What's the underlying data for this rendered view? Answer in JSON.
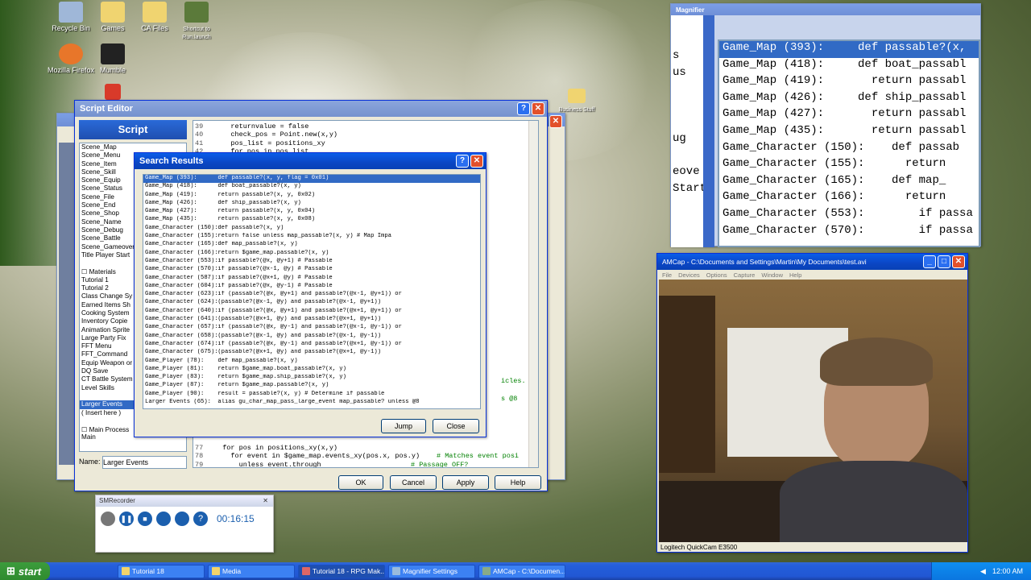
{
  "desktop": {
    "icons": [
      {
        "label": "Recycle Bin",
        "color": "#9fb7d8"
      },
      {
        "label": "Games",
        "color": "#f0d470"
      },
      {
        "label": "CA Files",
        "color": "#f0d470"
      },
      {
        "label": "Shortcut to Run.launch",
        "color": "#5b7a3a"
      },
      {
        "label": "Mozilla Firefox",
        "color": "#e8762a"
      },
      {
        "label": "Mumble",
        "color": "#222222"
      },
      {
        "label": "",
        "color": "#d83a2a"
      },
      {
        "label": "Business Stuff",
        "color": "#f0d470"
      }
    ]
  },
  "script_editor": {
    "title": "Script Editor",
    "panel_header": "Script",
    "scripts": [
      "Scene_Map",
      "Scene_Menu",
      "Scene_Item",
      "Scene_Skill",
      "Scene_Equip",
      "Scene_Status",
      "Scene_File",
      "Scene_End",
      "Scene_Shop",
      "Scene_Name",
      "Scene_Debug",
      "Scene_Battle",
      "Scene_Gameover",
      "Title Player Start",
      "",
      "☐ Materials",
      "Tutorial 1",
      "Tutorial 2",
      "Class Change Sy",
      "Earned Items Sh",
      "Cooking System",
      "Inventory Copie",
      "Animation Sprite",
      "Large Party Fix",
      "FFT Menu",
      "FFT_Command",
      "Equip Weapon or",
      "DQ Save",
      "CT Battle System",
      "Level Skills",
      "",
      "Larger Events",
      "( Insert here )",
      "",
      "☐ Main Process",
      "Main"
    ],
    "selected_script": "Larger Events",
    "name_label": "Name:",
    "name_value": "Larger Events",
    "code_top": [
      {
        "n": "39",
        "t": "    returnvalue = false"
      },
      {
        "n": "40",
        "t": "    check_pos = Point.new(x,y)"
      },
      {
        "n": "41",
        "t": "    pos_list = positions_xy"
      },
      {
        "n": "42",
        "t": "    for pos in pos_list"
      }
    ],
    "code_bottom": [
      {
        "n": "77",
        "t": "  for pos in positions_xy(x,y)"
      },
      {
        "n": "78",
        "t": "    for event in $game_map.events_xy(pos.x, pos.y)",
        "c": "# Matches event posi"
      },
      {
        "n": "79",
        "t": "      unless event.through",
        "c": "# Passage OFF?"
      }
    ],
    "right_fragments": [
      "icles.",
      "s @8"
    ],
    "buttons": {
      "ok": "OK",
      "cancel": "Cancel",
      "apply": "Apply",
      "help": "Help"
    }
  },
  "search_results": {
    "title": "Search Results",
    "results": [
      {
        "loc": "Game_Map (393):",
        "code": "  def passable?(x, y, flag = 0x01)"
      },
      {
        "loc": "Game_Map (418):",
        "code": "  def boat_passable?(x, y)"
      },
      {
        "loc": "Game_Map (419):",
        "code": "    return passable?(x, y, 0x02)"
      },
      {
        "loc": "Game_Map (426):",
        "code": "  def ship_passable?(x, y)"
      },
      {
        "loc": "Game_Map (427):",
        "code": "    return passable?(x, y, 0x04)"
      },
      {
        "loc": "Game_Map (435):",
        "code": "    return passable?(x, y, 0x08)"
      },
      {
        "loc": "Game_Character (150):",
        "code": "  def passable?(x, y)"
      },
      {
        "loc": "Game_Character (155):",
        "code": "    return false unless map_passable?(x, y)          # Map Impa"
      },
      {
        "loc": "Game_Character (165):",
        "code": "  def map_passable?(x, y)"
      },
      {
        "loc": "Game_Character (166):",
        "code": "    return $game_map.passable?(x, y)"
      },
      {
        "loc": "Game_Character (553):",
        "code": "      if passable?(@x, @y+1)                  # Passable"
      },
      {
        "loc": "Game_Character (570):",
        "code": "      if passable?(@x-1, @y)                  # Passable"
      },
      {
        "loc": "Game_Character (587):",
        "code": "      if passable?(@x+1, @y)                  # Passable"
      },
      {
        "loc": "Game_Character (604):",
        "code": "      if passable?(@x, @y-1)                  # Passable"
      },
      {
        "loc": "Game_Character (623):",
        "code": "      if (passable?(@x, @y+1) and passable?(@x-1, @y+1)) or"
      },
      {
        "loc": "Game_Character (624):",
        "code": "         (passable?(@x-1, @y) and passable?(@x-1, @y+1))"
      },
      {
        "loc": "Game_Character (640):",
        "code": "      if (passable?(@x, @y+1) and passable?(@x+1, @y+1)) or"
      },
      {
        "loc": "Game_Character (641):",
        "code": "         (passable?(@x+1, @y) and passable?(@x+1, @y+1))"
      },
      {
        "loc": "Game_Character (657):",
        "code": "      if (passable?(@x, @y-1) and passable?(@x-1, @y-1)) or"
      },
      {
        "loc": "Game_Character (658):",
        "code": "         (passable?(@x-1, @y) and passable?(@x-1, @y-1))"
      },
      {
        "loc": "Game_Character (674):",
        "code": "      if (passable?(@x, @y-1) and passable?(@x+1, @y-1)) or"
      },
      {
        "loc": "Game_Character (675):",
        "code": "         (passable?(@x+1, @y) and passable?(@x+1, @y-1))"
      },
      {
        "loc": "Game_Player (78):",
        "code": "  def map_passable?(x, y)"
      },
      {
        "loc": "Game_Player (81):",
        "code": "      return $game_map.boat_passable?(x, y)"
      },
      {
        "loc": "Game_Player (83):",
        "code": "      return $game_map.ship_passable?(x, y)"
      },
      {
        "loc": "Game_Player (87):",
        "code": "      return $game_map.passable?(x, y)"
      },
      {
        "loc": "Game_Player (90):",
        "code": "    result = passable?(x, y)              # Determine if passable"
      },
      {
        "loc": "Larger Events (65):",
        "code": "  alias gu_char_map_pass_large_event map_passable? unless @8"
      }
    ],
    "buttons": {
      "jump": "Jump",
      "close": "Close"
    }
  },
  "magnifier": {
    "title": "Magnifier",
    "left_fragments": [
      "s",
      "us",
      "",
      "",
      "",
      "ug",
      "",
      "eove",
      "Start",
      ""
    ],
    "lines": [
      "Game_Map (393):     def passable?(x,",
      "Game_Map (418):     def boat_passabl",
      "Game_Map (419):       return passabl",
      "Game_Map (426):     def ship_passabl",
      "Game_Map (427):       return passabl",
      "Game_Map (435):       return passabl",
      "Game_Character (150):    def passab",
      "Game_Character (155):      return ",
      "Game_Character (165):    def map_",
      "Game_Character (166):      return ",
      "Game_Character (553):        if passa",
      "Game_Character (570):        if passa"
    ]
  },
  "amcap": {
    "title": "AMCap - C:\\Documents and Settings\\Martin\\My Documents\\test.avi",
    "menu": [
      "File",
      "Devices",
      "Options",
      "Capture",
      "Window",
      "Help"
    ],
    "status": "Logitech QuickCam E3500"
  },
  "smrecorder": {
    "title": "SMRecorder",
    "time": "00:16:15"
  },
  "taskbar": {
    "start": "start",
    "tasks": [
      "Tutorial 18",
      "Media",
      "Tutorial 18 - RPG Mak...",
      "Magnifier Settings",
      "AMCap - C:\\Documen..."
    ],
    "clock": "12:00 AM"
  }
}
